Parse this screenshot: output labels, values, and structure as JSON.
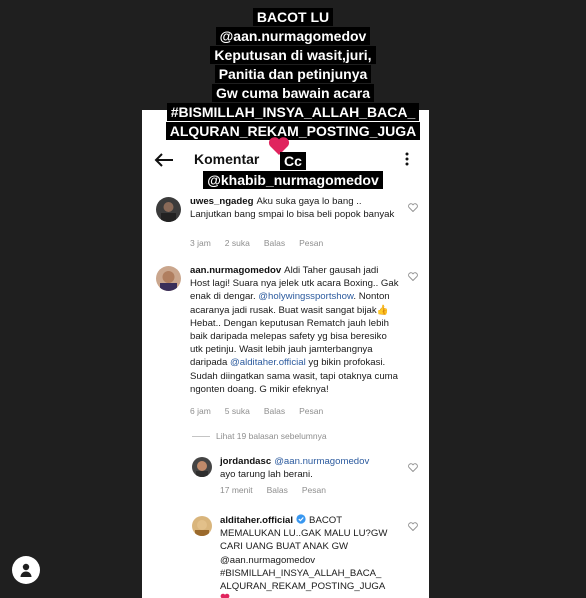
{
  "story": {
    "lines": [
      "BACOT LU",
      "@aan.nurmagomedov",
      "Keputusan di wasit,juri,",
      "Panitia dan petinjunya",
      "Gw cuma bawain acara",
      "#BISMILLAH_INSYA_ALLAH_BACA_",
      "ALQURAN_REKAM_POSTING_JUGA"
    ],
    "cc_label": "Cc",
    "mention": "@khabib_nurmagomedov"
  },
  "header": {
    "title": "Komentar"
  },
  "comments": [
    {
      "username": "uwes_ngadeg",
      "text": "Aku suka gaya lo bang .. Lanjutkan bang smpai lo bisa beli popok banyak",
      "time": "3 jam",
      "likes": "2 suka",
      "reply": "Balas",
      "send": "Pesan"
    },
    {
      "username": "aan.nurmagomedov",
      "text_a": "Aldi Taher gausah jadi Host lagi! Suara nya jelek utk acara Boxing.. Gak enak di dengar.",
      "tag1": "@holywingssportshow",
      "text_b": ". Nonton acaranya jadi rusak. Buat wasit sangat bijak👍 Hebat.. Dengan keputusan Rematch jauh lebih baik daripada melepas safety yg bisa beresiko utk petinju. Wasit lebih jauh jamterbangnya daripada",
      "tag2": "@alditaher.official",
      "text_c": "yg bikin profokasi. Sudah diingatkan sama wasit, tapi otaknya cuma ngonten doang. G mikir efeknya!",
      "time": "6 jam",
      "likes": "5 suka",
      "reply": "Balas",
      "send": "Pesan"
    }
  ],
  "view_replies": "Lihat 19 balasan sebelumnya",
  "replies": [
    {
      "username": "jordandasc",
      "tag": "@aan.nurmagomedov",
      "text": "ayo tarung lah berani.",
      "time": "17 menit",
      "reply": "Balas",
      "send": "Pesan"
    },
    {
      "username": "alditaher.official",
      "text": "BACOT MEMALUKAN LU..GAK MALU LU?GW CARI UANG BUAT ANAK GW @aan.nurmagomedov #BISMILLAH_INSYA_ALLAH_BACA_ ALQURAN_REKAM_POSTING_JUGA"
    }
  ],
  "colors": {
    "verified": "#3897f0",
    "link": "#2b5a9e",
    "heart": "#e0245e"
  }
}
